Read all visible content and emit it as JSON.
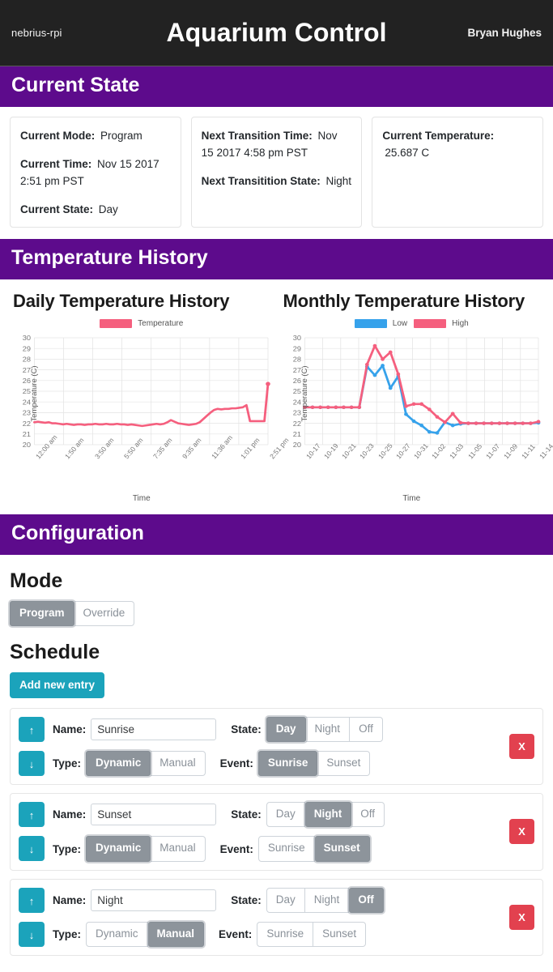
{
  "navbar": {
    "brand": "nebrius-rpi",
    "title": "Aquarium Control",
    "user": "Bryan Hughes"
  },
  "sections": {
    "current_state": "Current State",
    "temperature_history": "Temperature History",
    "configuration": "Configuration"
  },
  "current_state": {
    "cards": [
      {
        "rows": [
          {
            "label": "Current Mode:",
            "value": "Program"
          },
          {
            "label": "Current Time:",
            "value": "Nov 15 2017 2:51 pm PST"
          },
          {
            "label": "Current State:",
            "value": "Day"
          }
        ]
      },
      {
        "rows": [
          {
            "label": "Next Transition Time:",
            "value": "Nov 15 2017 4:58 pm PST"
          },
          {
            "label": "Next Transitition State:",
            "value": "Night"
          }
        ]
      },
      {
        "rows": [
          {
            "label": "Current Temperature:",
            "value": "25.687 C"
          }
        ]
      }
    ]
  },
  "configuration": {
    "mode_heading": "Mode",
    "mode_options": [
      {
        "label": "Program",
        "active": true
      },
      {
        "label": "Override",
        "active": false
      }
    ],
    "schedule_heading": "Schedule",
    "add_entry_label": "Add new entry",
    "up_arrow": "↑",
    "down_arrow": "↓",
    "delete_label": "X",
    "labels": {
      "name": "Name:",
      "state": "State:",
      "type": "Type:",
      "event": "Event:"
    },
    "entries": [
      {
        "name": "Sunrise",
        "state_options": [
          {
            "label": "Day",
            "active": true
          },
          {
            "label": "Night",
            "active": false
          },
          {
            "label": "Off",
            "active": false
          }
        ],
        "type_options": [
          {
            "label": "Dynamic",
            "active": true
          },
          {
            "label": "Manual",
            "active": false
          }
        ],
        "event_options": [
          {
            "label": "Sunrise",
            "active": true
          },
          {
            "label": "Sunset",
            "active": false
          }
        ]
      },
      {
        "name": "Sunset",
        "state_options": [
          {
            "label": "Day",
            "active": false
          },
          {
            "label": "Night",
            "active": true
          },
          {
            "label": "Off",
            "active": false
          }
        ],
        "type_options": [
          {
            "label": "Dynamic",
            "active": true
          },
          {
            "label": "Manual",
            "active": false
          }
        ],
        "event_options": [
          {
            "label": "Sunrise",
            "active": false
          },
          {
            "label": "Sunset",
            "active": true
          }
        ]
      },
      {
        "name": "Night",
        "state_options": [
          {
            "label": "Day",
            "active": false
          },
          {
            "label": "Night",
            "active": false
          },
          {
            "label": "Off",
            "active": true
          }
        ],
        "type_options": [
          {
            "label": "Dynamic",
            "active": false
          },
          {
            "label": "Manual",
            "active": true
          }
        ],
        "event_options": [
          {
            "label": "Sunrise",
            "active": false
          },
          {
            "label": "Sunset",
            "active": false
          }
        ]
      }
    ]
  },
  "colors": {
    "navbar_bg": "#222222",
    "section_purple": "#5d0b8c",
    "teal": "#1ba3bb",
    "red": "#e2414f",
    "active_gray": "#8d949b",
    "series_high": "#f55f7e",
    "series_low": "#36a2eb"
  },
  "chart_data": [
    {
      "type": "line",
      "title": "Daily Temperature History",
      "xlabel": "Time",
      "ylabel": "Temperature (C)",
      "ylim": [
        20,
        30
      ],
      "yticks": [
        20,
        21,
        22,
        23,
        24,
        25,
        26,
        27,
        28,
        29,
        30
      ],
      "grid": true,
      "legend_position": "top",
      "tick_labels": [
        "12:00 am",
        "1:50 am",
        "3:50 am",
        "5:50 am",
        "7:35 am",
        "9:35 am",
        "11:36 am",
        "1:01 pm",
        "2:51 pm"
      ],
      "series": [
        {
          "name": "Temperature",
          "color": "#f55f7e",
          "values": [
            22.1,
            22.15,
            22.1,
            22.05,
            22.1,
            22.0,
            22.0,
            21.95,
            21.9,
            21.95,
            21.9,
            21.85,
            21.9,
            21.9,
            21.85,
            21.9,
            21.9,
            21.95,
            21.9,
            21.9,
            21.95,
            21.9,
            21.9,
            21.95,
            21.9,
            21.9,
            21.85,
            21.9,
            21.85,
            21.8,
            21.75,
            21.8,
            21.85,
            21.9,
            21.95,
            21.9,
            21.95,
            22.1,
            22.3,
            22.15,
            22.0,
            21.95,
            21.9,
            21.85,
            21.9,
            21.95,
            22.1,
            22.4,
            22.7,
            23.0,
            23.25,
            23.35,
            23.3,
            23.35,
            23.35,
            23.4,
            23.4,
            23.45,
            23.5,
            23.7,
            22.2,
            22.2,
            22.2,
            22.2,
            22.2,
            25.687
          ]
        }
      ]
    },
    {
      "type": "line",
      "title": "Monthly Temperature History",
      "xlabel": "Time",
      "ylabel": "Temperature (C)",
      "ylim": [
        20,
        30
      ],
      "yticks": [
        20,
        21,
        22,
        23,
        24,
        25,
        26,
        27,
        28,
        29,
        30
      ],
      "grid": true,
      "legend_position": "top",
      "tick_labels": [
        "10-17",
        "10-19",
        "10-21",
        "10-23",
        "10-25",
        "10-27",
        "10-31",
        "11-02",
        "11-03",
        "11-05",
        "11-07",
        "11-09",
        "11-11",
        "11-14"
      ],
      "series": [
        {
          "name": "Low",
          "color": "#36a2eb",
          "values": [
            23.5,
            23.5,
            23.5,
            23.5,
            23.5,
            23.5,
            23.5,
            23.5,
            27.3,
            26.5,
            27.4,
            25.3,
            26.4,
            22.85,
            22.2,
            21.8,
            21.2,
            21.1,
            22.1,
            21.8,
            21.95,
            22.0,
            22.0,
            22.0,
            22.0,
            22.0,
            22.0,
            22.0,
            22.0,
            22.0,
            22.05
          ]
        },
        {
          "name": "High",
          "color": "#f55f7e",
          "values": [
            23.5,
            23.5,
            23.5,
            23.5,
            23.5,
            23.5,
            23.5,
            23.5,
            27.5,
            29.25,
            28.0,
            28.65,
            26.6,
            23.6,
            23.8,
            23.8,
            23.3,
            22.6,
            22.1,
            22.9,
            22.05,
            22.0,
            22.0,
            22.0,
            22.0,
            22.0,
            22.0,
            22.0,
            22.0,
            22.0,
            22.15
          ]
        }
      ]
    }
  ]
}
